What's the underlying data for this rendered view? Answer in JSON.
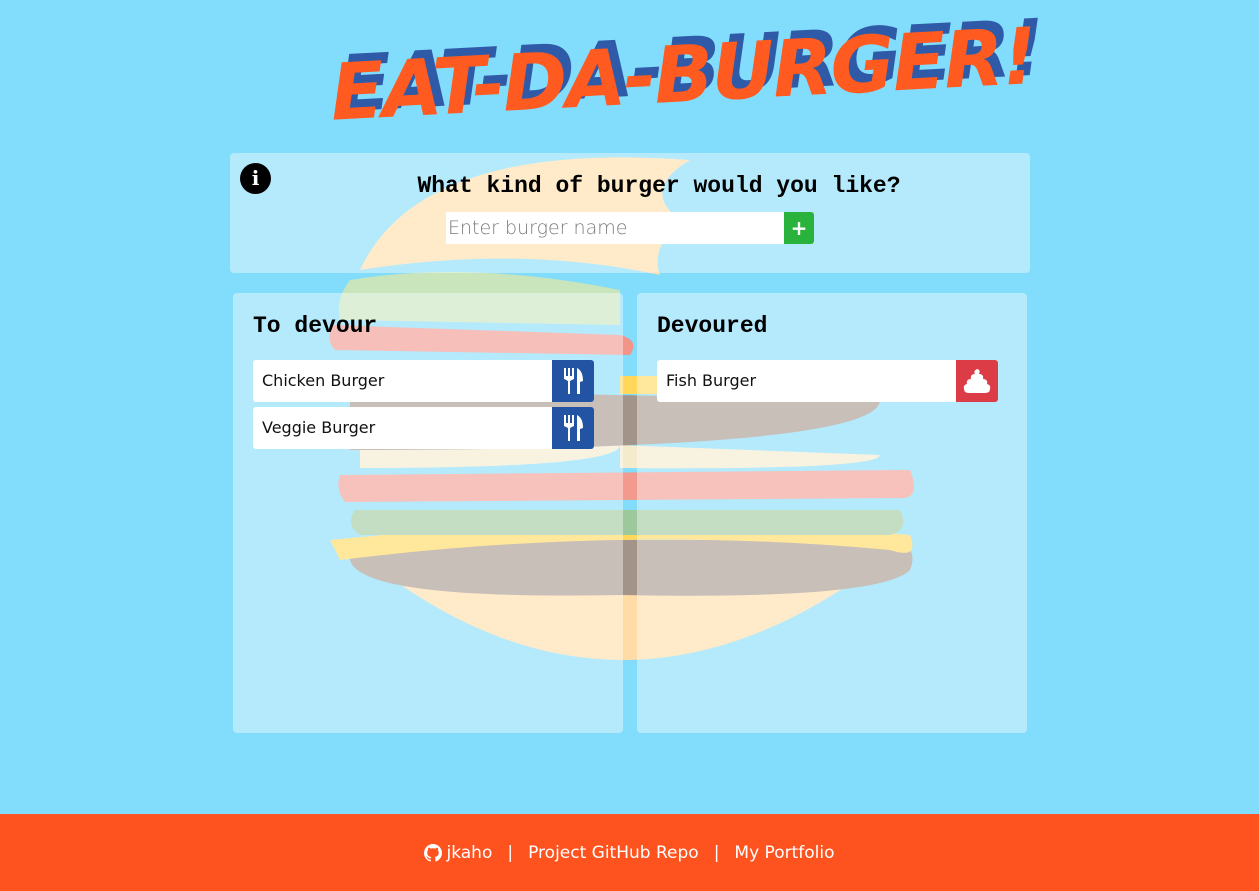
{
  "header": {
    "logo_text": "EAT-DA-BURGER!"
  },
  "form": {
    "question": "What kind of burger would you like?",
    "input_placeholder": "Enter burger name",
    "input_value": "",
    "add_label": "+",
    "info_icon": "info-icon"
  },
  "columns": {
    "to_devour": {
      "title": "To devour",
      "items": [
        {
          "name": "Chicken Burger",
          "action_icon": "utensils-icon"
        },
        {
          "name": "Veggie Burger",
          "action_icon": "utensils-icon"
        }
      ]
    },
    "devoured": {
      "title": "Devoured",
      "items": [
        {
          "name": "Fish Burger",
          "action_icon": "poop-icon"
        }
      ]
    }
  },
  "footer": {
    "github_user": "jkaho",
    "separator": "|",
    "repo_label": "Project GitHub Repo",
    "portfolio_label": "My Portfolio"
  },
  "colors": {
    "background": "#82dcfb",
    "footer": "#ff531f",
    "logo_front": "#ff5a1f",
    "logo_shadow": "#2f5aa8",
    "devour_button": "#2254a3",
    "trash_button": "#dc3c46",
    "add_button": "#29b33d"
  }
}
